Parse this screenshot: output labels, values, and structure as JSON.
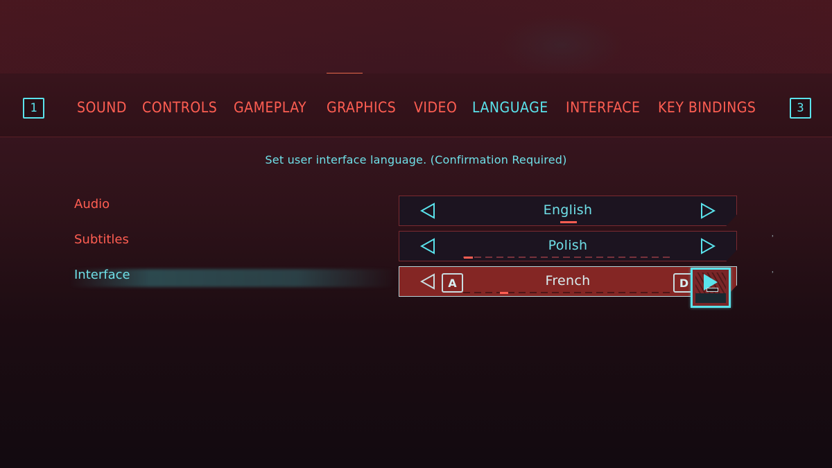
{
  "tab_bar": {
    "prev_key": "1",
    "next_key": "3",
    "tabs": [
      {
        "label": "SOUND",
        "active": false
      },
      {
        "label": "CONTROLS",
        "active": false
      },
      {
        "label": "GAMEPLAY",
        "active": false
      },
      {
        "label": "GRAPHICS",
        "active": false
      },
      {
        "label": "VIDEO",
        "active": false
      },
      {
        "label": "LANGUAGE",
        "active": true
      },
      {
        "label": "INTERFACE",
        "active": false
      },
      {
        "label": "KEY BINDINGS",
        "active": false
      }
    ]
  },
  "description": "Set user interface language. (Confirmation Required)",
  "settings": [
    {
      "label": "Audio",
      "value": "English",
      "active": false,
      "position_fraction": 0.5
    },
    {
      "label": "Subtitles",
      "value": "Polish",
      "active": false,
      "position_fraction": 0.05
    },
    {
      "label": "Interface",
      "value": "French",
      "active": true,
      "position_fraction": 0.2,
      "prev_key": "A",
      "next_key": "D"
    }
  ],
  "colors": {
    "accent_red": "#ff5e52",
    "accent_cyan": "#5ae3ec",
    "active_row_bg": "#842624"
  },
  "side_marks": [
    "ʾ",
    "ʾ"
  ]
}
